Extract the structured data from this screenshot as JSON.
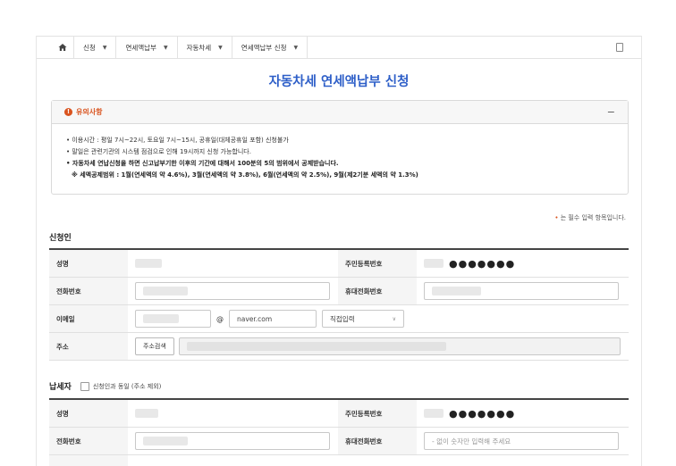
{
  "breadcrumb": [
    {
      "label": "신청"
    },
    {
      "label": "연세액납부"
    },
    {
      "label": "자동차세"
    },
    {
      "label": "연세액납부 신청"
    }
  ],
  "page_title": "자동차세 연세액납부 신청",
  "notice": {
    "title": "유의사항",
    "collapse_label": "−",
    "lines": [
      "• 이용시간 : 평일 7시~22시, 토요일 7시~15시, 공휴일(대체공휴일 포함) 신청불가",
      "• 말일은 관련기관의 시스템 점검으로 인해 19시까지 신청 가능합니다.",
      "• 자동차세 연납신청을 하면 신고납부기한 이후의 기간에 대해서 100분의 5의 범위에서 공제받습니다.",
      "※ 세액공제범위 : 1월(연세액의 약 4.6%), 3월(연세액의 약 3.8%), 6월(연세액의 약 2.5%), 9월(제2기분 세액의 약 1.3%)"
    ]
  },
  "required_note": {
    "star": "•",
    "text": " 는 필수 입력 항목입니다."
  },
  "applicant": {
    "section_title": "신청인",
    "name_label": "성명",
    "rrn_label": "주민등록번호",
    "rrn_masked": "●●●●●●●",
    "phone_label": "전화번호",
    "mobile_label": "휴대전화번호",
    "email_label": "이메일",
    "email_at": "@",
    "email_domain": "naver.com",
    "email_select": "직접입력",
    "address_label": "주소",
    "address_button": "주소검색"
  },
  "taxpayer": {
    "section_title": "납세자",
    "same_as_label": "신청인과 동일 (주소 제외)",
    "name_label": "성명",
    "rrn_label": "주민등록번호",
    "rrn_masked": "●●●●●●●",
    "phone_label": "전화번호",
    "mobile_label": "휴대전화번호",
    "mobile_placeholder": "- 없이 숫자만 입력해 주세요"
  },
  "colors": {
    "accent": "#2e5fc8",
    "warning": "#d9531e"
  }
}
